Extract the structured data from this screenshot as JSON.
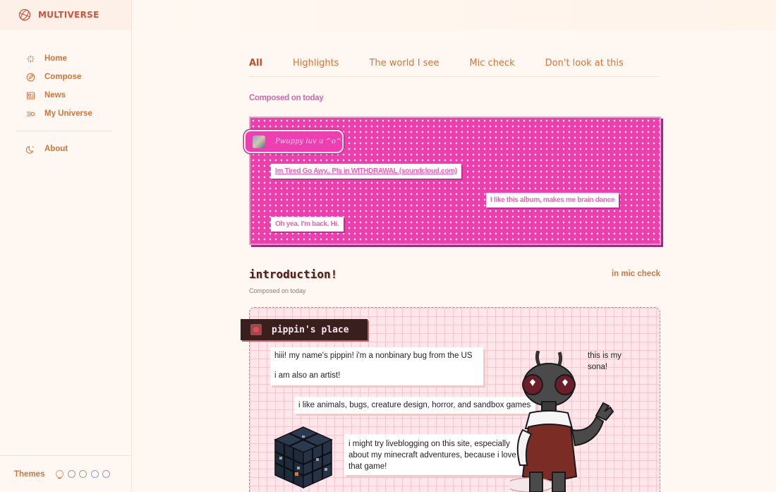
{
  "app": {
    "name": "MULTIVERSE"
  },
  "sidebar": {
    "items": [
      {
        "label": "Home",
        "icon": "sparkle-icon"
      },
      {
        "label": "Compose",
        "icon": "compose-icon"
      },
      {
        "label": "News",
        "icon": "news-icon"
      },
      {
        "label": "My Universe",
        "icon": "universe-icon"
      }
    ],
    "about": {
      "label": "About",
      "icon": "moon-icon"
    },
    "themes": {
      "label": "Themes",
      "swatches": [
        "#e0a070",
        "#a89a94",
        "#9aa89a",
        "#8aa0d8",
        "#a090e0"
      ]
    }
  },
  "tabs": [
    "All",
    "Highlights",
    "The world I see",
    "Mic check",
    "Don't look at this"
  ],
  "feed": {
    "composed_today": "Composed on today",
    "pink_post": {
      "badge_text": "Pwuppy luv u ^o^",
      "notes": [
        "Im Tired Go Awy.. Pls in WITHDRAWAL (soundcloud.com)",
        "I like this album, makes me brain dance",
        "Oh yea. I'm back. Hi."
      ]
    },
    "intro_post": {
      "title": "introduction!",
      "collection_prefix": "in",
      "collection_name": "mic check",
      "date": "Composed on today",
      "header": "pippin's place",
      "lines": [
        "hiii! my name's pippin! i'm a nonbinary bug from the US",
        "i am also an artist!",
        "i like animals, bugs, creature design, horror, and sandbox games",
        "i might try liveblogging on this site, especially about my minecraft adventures, because i love that game!",
        "this is my sona!"
      ]
    }
  },
  "colors": {
    "accent": "#d2753a",
    "brand": "#c8553d",
    "pink": "#ec3fae"
  }
}
